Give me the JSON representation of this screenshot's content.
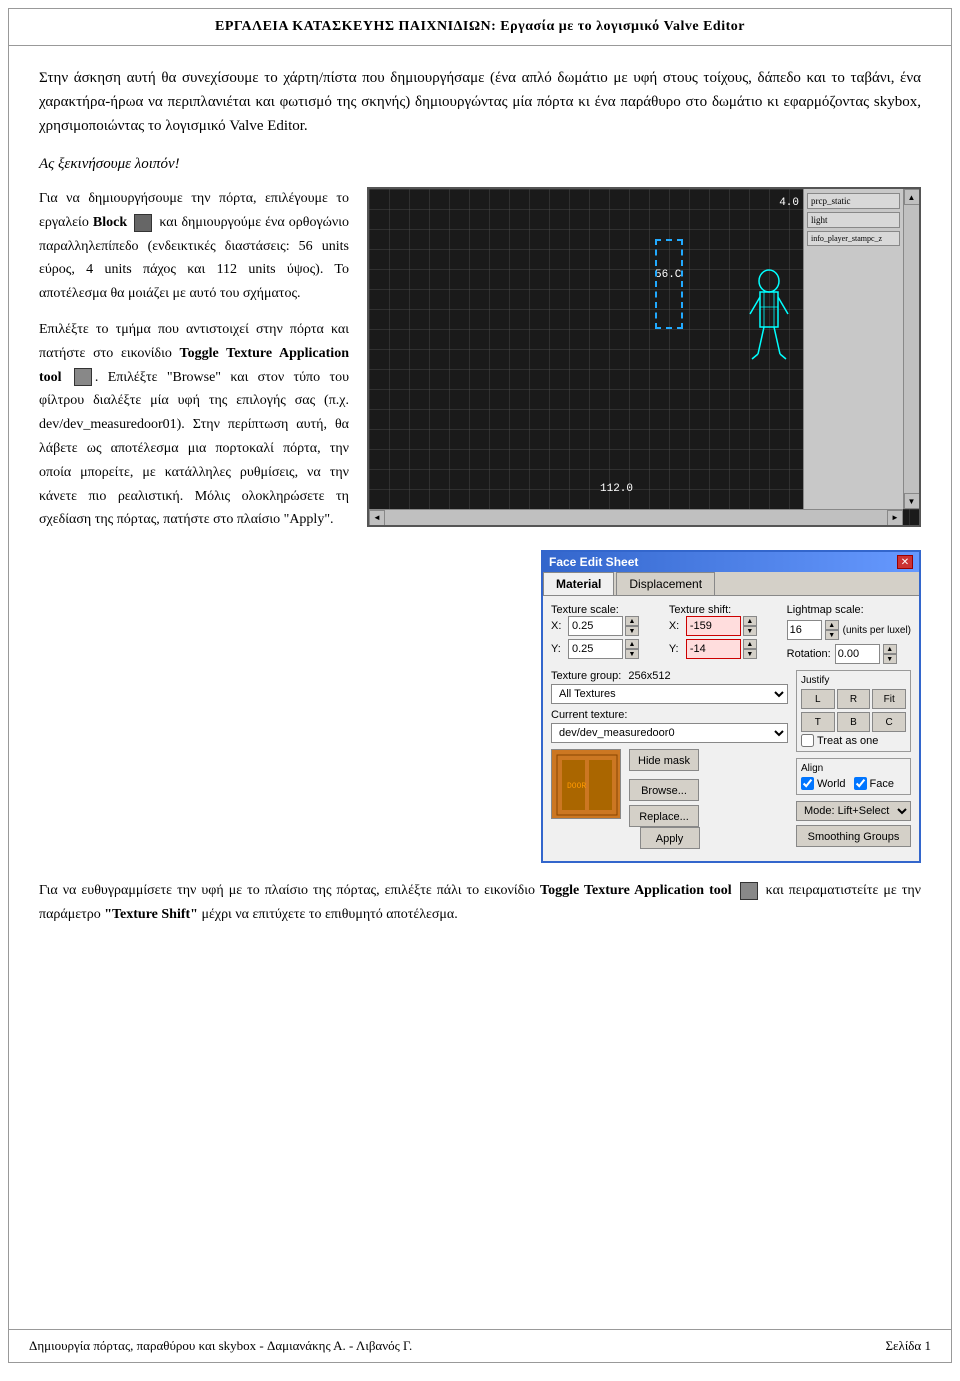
{
  "header": {
    "title": "ΕΡΓΑΛΕΙΑ ΚΑΤΑΣΚΕΥΗΣ ΠΑΙΧΝΙΔΙΩΝ: Εργασία με το λογισμικό Valve Editor"
  },
  "intro": {
    "paragraph": "Στην άσκηση αυτή θα συνεχίσουμε το χάρτη/πίστα που δημιουργήσαμε (ένα απλό δωμάτιο με υφή στους τοίχους, δάπεδο και το ταβάνι, ένα χαρακτήρα-ήρωα να περιπλανιέται  και φωτισμό της σκηνής) δημιουργώντας μία πόρτα κι ένα παράθυρο στο δωμάτιο κι εφαρμόζοντας skybox, χρησιμοποιώντας το λογισμικό Valve Editor."
  },
  "section_start": {
    "text": "Ας ξεκινήσουμε λοιπόν!"
  },
  "col_left": {
    "para1": "Για να δημιουργήσουμε την πόρτα, επιλέγουμε το εργαλείο Block  και δημιουργούμε ένα ορθογώνιο παραλληλεπίπεδο (ενδεικτικές διαστάσεις: 56 units εύρος, 4 units πάχος και 112 units ύψος). Το αποτέλεσμα θα μοιάζει με αυτό του σχήματος.",
    "para2": "Επιλέξτε το τμήμα που αντιστοιχεί στην πόρτα και πατήστε στο εικονίδιο Toggle Texture Application tool . Επιλέξτε \"Browse\" και στον τύπο του φίλτρου διαλέξτε μία υφή της επιλογής σας (π.χ. dev/dev_measuredoor01). Στην περίπτωση αυτή, θα λάβετε ως αποτέλεσμα μια πορτοκαλί πόρτα, την οποία μπορείτε, με κατάλληλες ρυθμίσεις, να την κάνετε πιο ρεαλιστική. Μόλις ολοκληρώσετε τη σχεδίαση της πόρτας, πατήστε στο πλαίσιο \"Apply\"."
  },
  "bottom_text": {
    "text": "Για να ευθυγραμμίσετε την υφή με το πλαίσιο της πόρτας, επιλέξτε πάλι το εικονίδιο Toggle Texture Application tool  και πειραματιστείτε με την παράμετρο \"Texture Shift\" μέχρι να επιτύχετε το επιθυμητό αποτέλεσμα."
  },
  "editor": {
    "measurement_top": "4.0",
    "measurement_mid": "56.C",
    "measurement_bot": "112.0",
    "panel_items": [
      "prcp_static",
      "light",
      "info_player_stampc_z"
    ]
  },
  "dialog": {
    "title": "Face Edit Sheet",
    "close_btn": "✕",
    "tabs": [
      "Material",
      "Displacement"
    ],
    "active_tab": "Material",
    "texture_scale_label": "Texture scale:",
    "texture_shift_label": "Texture shift:",
    "lightmap_scale_label": "Lightmap scale:",
    "lightmap_units": "(units per luxel)",
    "rotation_label": "Rotation:",
    "x_label": "X:",
    "y_label": "Y:",
    "scale_x_val": "0.25",
    "scale_y_val": "0.25",
    "shift_x_val": "-159",
    "shift_y_val": "-14",
    "lightmap_val": "16",
    "rotation_val": "0.00",
    "texture_group_label": "Texture group:",
    "texture_group_size": "256x512",
    "texture_group_dropdown": "All Textures",
    "current_texture_label": "Current texture:",
    "current_texture_val": "dev/dev_measuredoor0",
    "hide_mask_btn": "Hide mask",
    "browse_btn": "Browse...",
    "replace_btn": "Replace...",
    "apply_btn": "Apply",
    "justify_label": "Justify",
    "justify_buttons": [
      "L",
      "R",
      "Fit",
      "T",
      "B",
      "C"
    ],
    "treat_as_one_label": "Treat as one",
    "align_label": "Align",
    "align_world": "World",
    "align_face": "Face",
    "mode_label": "Mode: Lift+Select",
    "smoothing_btn": "Smoothing Groups"
  },
  "footer": {
    "left": "Δημιουργία πόρτας, παραθύρου και skybox - Δαμιανάκης Α. - Λιβανός Γ.",
    "right": "Σελίδα 1"
  }
}
